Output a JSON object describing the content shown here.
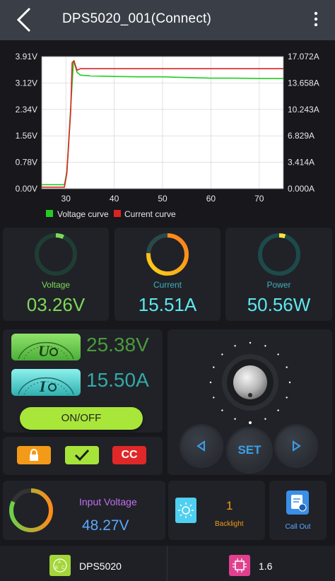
{
  "header": {
    "title": "DPS5020_001(Connect)",
    "back_icon": "chevron-left-icon",
    "menu_icon": "kebab-menu-icon"
  },
  "chart_data": {
    "type": "line",
    "x_ticks": [
      "30",
      "40",
      "50",
      "60",
      "70"
    ],
    "xlim": [
      25,
      75
    ],
    "y_left_ticks": [
      "3.91V",
      "3.12V",
      "2.34V",
      "1.56V",
      "0.78V",
      "0.00V"
    ],
    "y_right_ticks": [
      "17.072A",
      "13.658A",
      "10.243A",
      "6.829A",
      "3.414A",
      "0.000A"
    ],
    "ylim_left": [
      0,
      3.91
    ],
    "ylim_right": [
      0,
      17.072
    ],
    "grid": true,
    "legend_position": "bottom-left",
    "series": [
      {
        "name": "Voltage curve",
        "color": "#22cc22",
        "axis": "left",
        "x": [
          25,
          29.7,
          30.2,
          31,
          31.6,
          32.3,
          33,
          35,
          40,
          45,
          50,
          55,
          60,
          65,
          70,
          75
        ],
        "y": [
          0.12,
          0.12,
          0.5,
          2.4,
          3.8,
          3.45,
          3.36,
          3.34,
          3.32,
          3.31,
          3.31,
          3.29,
          3.27,
          3.27,
          3.26,
          3.26
        ]
      },
      {
        "name": "Current curve",
        "color": "#dd2222",
        "axis": "right",
        "x": [
          25,
          29.7,
          30.2,
          31,
          31.3,
          31.7,
          32.3,
          33,
          40,
          50,
          60,
          70,
          75
        ],
        "y": [
          0.2,
          0.2,
          2.0,
          10.0,
          16.3,
          16.5,
          15.3,
          15.5,
          15.5,
          15.5,
          15.5,
          15.5,
          15.5
        ]
      }
    ]
  },
  "metrics": [
    {
      "label": "Voltage",
      "value": "03.26V",
      "label_color": "#7ed957",
      "value_color": "#7ed957",
      "ring_fraction": 0.065
    },
    {
      "label": "Current",
      "value": "15.51A",
      "label_color": "#3fb0bf",
      "value_color": "#5ee8f0",
      "ring_fraction": 0.76
    },
    {
      "label": "Power",
      "value": "50.56W",
      "label_color": "#3fb0bf",
      "value_color": "#5ee8f0",
      "ring_fraction": 0.05
    }
  ],
  "set_voltage": {
    "value": "25.38V",
    "icon": "voltage-gauge-icon",
    "color": "#4a9a3c"
  },
  "set_current": {
    "value": "15.50A",
    "icon": "current-gauge-icon",
    "color": "#33a9a9"
  },
  "onoff_label": "ON/OFF",
  "controls": {
    "lock_icon": "lock-icon",
    "confirm_icon": "checkmark-icon",
    "mode_label": "CC"
  },
  "knob": {
    "icon": "rotary-knob-icon",
    "left_icon": "arrow-left-icon",
    "right_icon": "arrow-right-icon",
    "set_label": "SET"
  },
  "input_voltage": {
    "label": "Input Voltage",
    "value": "48.27V",
    "ring_fraction": 0.82
  },
  "backlight": {
    "value": "1",
    "label": "Backlight",
    "icon": "sun-icon"
  },
  "call_out": {
    "label": "Call Out",
    "icon": "document-chart-icon"
  },
  "bottom": {
    "device": "DPS5020",
    "device_icon": "abc-device-icon",
    "version": "1.6",
    "version_icon": "firmware-chip-icon"
  }
}
